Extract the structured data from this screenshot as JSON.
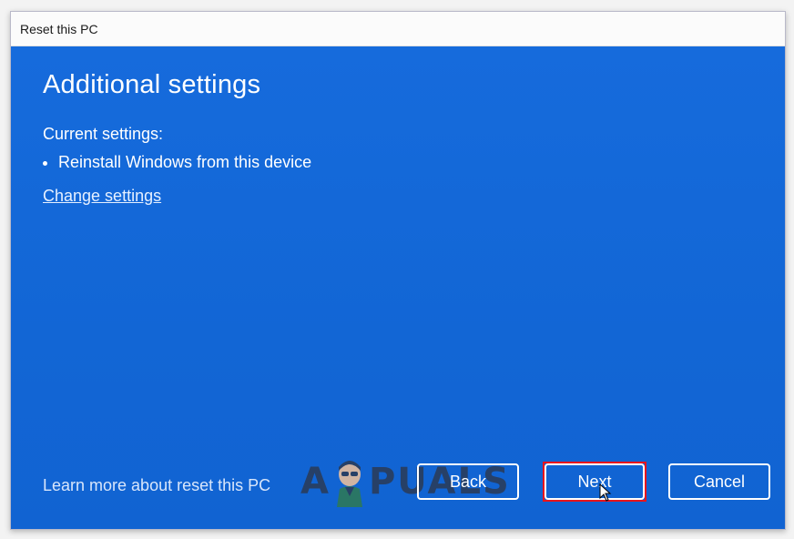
{
  "window": {
    "title": "Reset this PC"
  },
  "main": {
    "heading": "Additional settings",
    "current_label": "Current settings:",
    "settings": [
      "Reinstall Windows from this device"
    ],
    "change_link": "Change settings",
    "learn_more": "Learn more about reset this PC"
  },
  "buttons": {
    "back": "Back",
    "next": "Next",
    "cancel": "Cancel"
  },
  "watermark": {
    "text_left": "A",
    "text_right": "PUALS"
  },
  "colors": {
    "dialog_bg": "#1569d8",
    "highlight": "#e8141c"
  }
}
